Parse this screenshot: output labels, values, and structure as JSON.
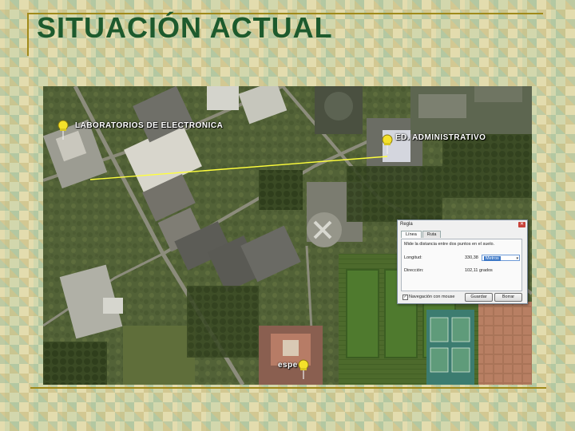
{
  "slide": {
    "title": "SITUACIÓN ACTUAL"
  },
  "map": {
    "labels": {
      "laboratorios": "LABORATORIOS DE ELECTRONICA",
      "administrativo": "ED. ADMINISTRATIVO",
      "espe": "espe"
    },
    "icons": {
      "pin": "yellow-pushpin-icon"
    },
    "colors": {
      "measure_line": "#ffff3c",
      "pin": "#f4e12a"
    }
  },
  "ruler_dialog": {
    "title": "Regla",
    "tabs": [
      {
        "label": "Línea",
        "active": true
      },
      {
        "label": "Ruta",
        "active": false
      }
    ],
    "description": "Mide la distancia entre dos puntos en el suelo.",
    "length_label": "Longitud:",
    "length_value": "330,38",
    "unit_selected": "Metros",
    "direction_label": "Dirección:",
    "direction_value": "102,11 grados",
    "mouse_nav_label": "Navegación con mouse",
    "mouse_nav_checked": true,
    "save_button": "Guardar",
    "clear_button": "Borrar"
  }
}
